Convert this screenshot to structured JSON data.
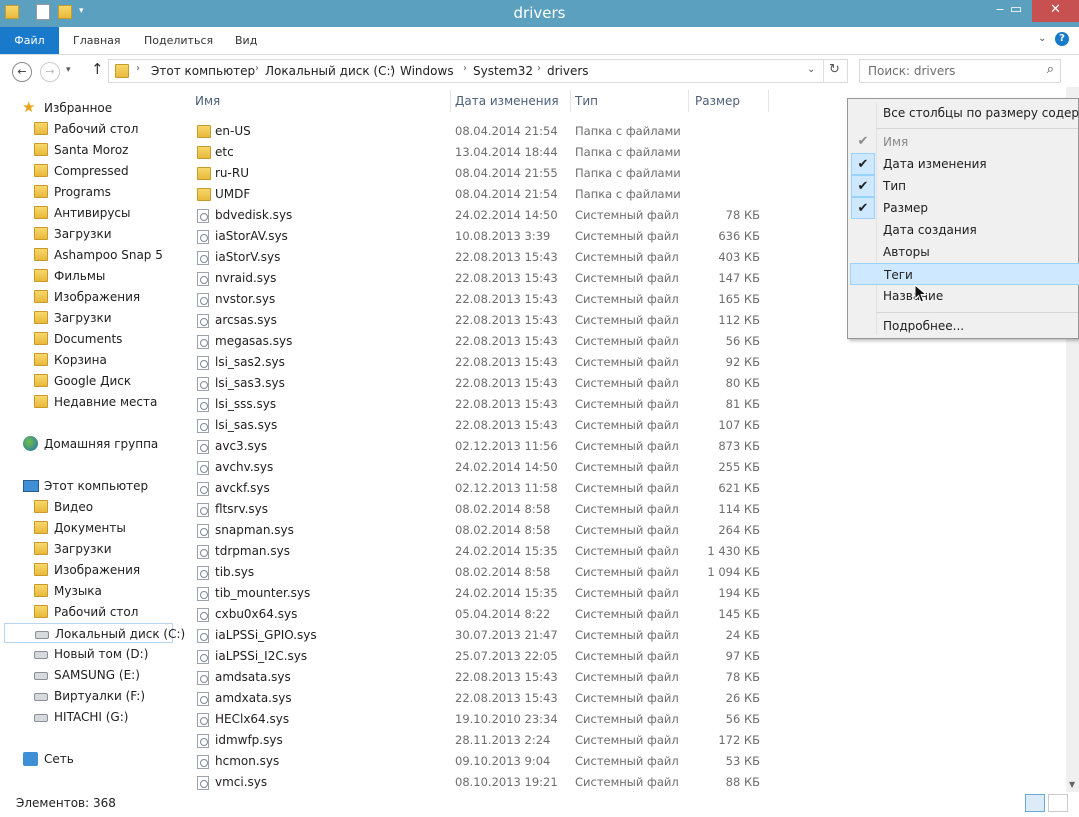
{
  "window": {
    "title": "drivers"
  },
  "ribbon": {
    "tabs": [
      "Файл",
      "Главная",
      "Поделиться",
      "Вид"
    ]
  },
  "address": {
    "crumbs": [
      "Этот компьютер",
      "Локальный диск (C:)",
      "Windows",
      "System32",
      "drivers"
    ],
    "search_placeholder": "Поиск: drivers"
  },
  "nav": {
    "favorites_header": "Избранное",
    "favorites": [
      "Рабочий стол",
      "Santa Moroz",
      "Compressed",
      "Programs",
      "Антивирусы",
      "Загрузки",
      "Ashampoo Snap 5",
      "Фильмы",
      "Изображения",
      "Загрузки",
      "Documents",
      "Корзина",
      "Google Диск",
      "Недавние места"
    ],
    "homegroup": "Домашняя группа",
    "computer_header": "Этот компьютер",
    "computer": [
      "Видео",
      "Документы",
      "Загрузки",
      "Изображения",
      "Музыка",
      "Рабочий стол",
      "Локальный диск (C:)",
      "Новый том (D:)",
      "SAMSUNG (E:)",
      "Виртуалки (F:)",
      "HITACHI (G:)"
    ],
    "network": "Сеть"
  },
  "columns": {
    "name": "Имя",
    "date": "Дата изменения",
    "type": "Тип",
    "size": "Размер"
  },
  "files": [
    {
      "name": "en-US",
      "date": "08.04.2014 21:54",
      "type": "Папка с файлами",
      "size": "",
      "folder": true
    },
    {
      "name": "etc",
      "date": "13.04.2014 18:44",
      "type": "Папка с файлами",
      "size": "",
      "folder": true
    },
    {
      "name": "ru-RU",
      "date": "08.04.2014 21:55",
      "type": "Папка с файлами",
      "size": "",
      "folder": true
    },
    {
      "name": "UMDF",
      "date": "08.04.2014 21:54",
      "type": "Папка с файлами",
      "size": "",
      "folder": true
    },
    {
      "name": "bdvedisk.sys",
      "date": "24.02.2014 14:50",
      "type": "Системный файл",
      "size": "78 КБ",
      "folder": false
    },
    {
      "name": "iaStorAV.sys",
      "date": "10.08.2013 3:39",
      "type": "Системный файл",
      "size": "636 КБ",
      "folder": false
    },
    {
      "name": "iaStorV.sys",
      "date": "22.08.2013 15:43",
      "type": "Системный файл",
      "size": "403 КБ",
      "folder": false
    },
    {
      "name": "nvraid.sys",
      "date": "22.08.2013 15:43",
      "type": "Системный файл",
      "size": "147 КБ",
      "folder": false
    },
    {
      "name": "nvstor.sys",
      "date": "22.08.2013 15:43",
      "type": "Системный файл",
      "size": "165 КБ",
      "folder": false
    },
    {
      "name": "arcsas.sys",
      "date": "22.08.2013 15:43",
      "type": "Системный файл",
      "size": "112 КБ",
      "folder": false
    },
    {
      "name": "megasas.sys",
      "date": "22.08.2013 15:43",
      "type": "Системный файл",
      "size": "56 КБ",
      "folder": false
    },
    {
      "name": "lsi_sas2.sys",
      "date": "22.08.2013 15:43",
      "type": "Системный файл",
      "size": "92 КБ",
      "folder": false
    },
    {
      "name": "lsi_sas3.sys",
      "date": "22.08.2013 15:43",
      "type": "Системный файл",
      "size": "80 КБ",
      "folder": false
    },
    {
      "name": "lsi_sss.sys",
      "date": "22.08.2013 15:43",
      "type": "Системный файл",
      "size": "81 КБ",
      "folder": false
    },
    {
      "name": "lsi_sas.sys",
      "date": "22.08.2013 15:43",
      "type": "Системный файл",
      "size": "107 КБ",
      "folder": false
    },
    {
      "name": "avc3.sys",
      "date": "02.12.2013 11:56",
      "type": "Системный файл",
      "size": "873 КБ",
      "folder": false
    },
    {
      "name": "avchv.sys",
      "date": "24.02.2014 14:50",
      "type": "Системный файл",
      "size": "255 КБ",
      "folder": false
    },
    {
      "name": "avckf.sys",
      "date": "02.12.2013 11:58",
      "type": "Системный файл",
      "size": "621 КБ",
      "folder": false
    },
    {
      "name": "fltsrv.sys",
      "date": "08.02.2014 8:58",
      "type": "Системный файл",
      "size": "114 КБ",
      "folder": false
    },
    {
      "name": "snapman.sys",
      "date": "08.02.2014 8:58",
      "type": "Системный файл",
      "size": "264 КБ",
      "folder": false
    },
    {
      "name": "tdrpman.sys",
      "date": "24.02.2014 15:35",
      "type": "Системный файл",
      "size": "1 430 КБ",
      "folder": false
    },
    {
      "name": "tib.sys",
      "date": "08.02.2014 8:58",
      "type": "Системный файл",
      "size": "1 094 КБ",
      "folder": false
    },
    {
      "name": "tib_mounter.sys",
      "date": "24.02.2014 15:35",
      "type": "Системный файл",
      "size": "194 КБ",
      "folder": false
    },
    {
      "name": "cxbu0x64.sys",
      "date": "05.04.2014 8:22",
      "type": "Системный файл",
      "size": "145 КБ",
      "folder": false
    },
    {
      "name": "iaLPSSi_GPIO.sys",
      "date": "30.07.2013 21:47",
      "type": "Системный файл",
      "size": "24 КБ",
      "folder": false
    },
    {
      "name": "iaLPSSi_I2C.sys",
      "date": "25.07.2013 22:05",
      "type": "Системный файл",
      "size": "97 КБ",
      "folder": false
    },
    {
      "name": "amdsata.sys",
      "date": "22.08.2013 15:43",
      "type": "Системный файл",
      "size": "78 КБ",
      "folder": false
    },
    {
      "name": "amdxata.sys",
      "date": "22.08.2013 15:43",
      "type": "Системный файл",
      "size": "26 КБ",
      "folder": false
    },
    {
      "name": "HEClx64.sys",
      "date": "19.10.2010 23:34",
      "type": "Системный файл",
      "size": "56 КБ",
      "folder": false
    },
    {
      "name": "idmwfp.sys",
      "date": "28.11.2013 2:24",
      "type": "Системный файл",
      "size": "172 КБ",
      "folder": false
    },
    {
      "name": "hcmon.sys",
      "date": "09.10.2013 9:04",
      "type": "Системный файл",
      "size": "53 КБ",
      "folder": false
    },
    {
      "name": "vmci.sys",
      "date": "08.10.2013 19:21",
      "type": "Системный файл",
      "size": "88 КБ",
      "folder": false
    }
  ],
  "context_menu": {
    "fit_all": "Все столбцы по размеру содержим",
    "items": [
      {
        "label": "Имя",
        "checked": true,
        "disabled": true
      },
      {
        "label": "Дата изменения",
        "checked": true,
        "disabled": false
      },
      {
        "label": "Тип",
        "checked": true,
        "disabled": false
      },
      {
        "label": "Размер",
        "checked": true,
        "disabled": false
      },
      {
        "label": "Дата создания",
        "checked": false,
        "disabled": false
      },
      {
        "label": "Авторы",
        "checked": false,
        "disabled": false
      },
      {
        "label": "Теги",
        "checked": false,
        "disabled": false,
        "highlighted": true
      },
      {
        "label": "Название",
        "checked": false,
        "disabled": false
      }
    ],
    "more": "Подробнее..."
  },
  "status": {
    "count": "Элементов: 368"
  },
  "icons": {
    "check": "check-icon",
    "accent": "#1979ca",
    "titlebar": "#5ba0bf"
  }
}
